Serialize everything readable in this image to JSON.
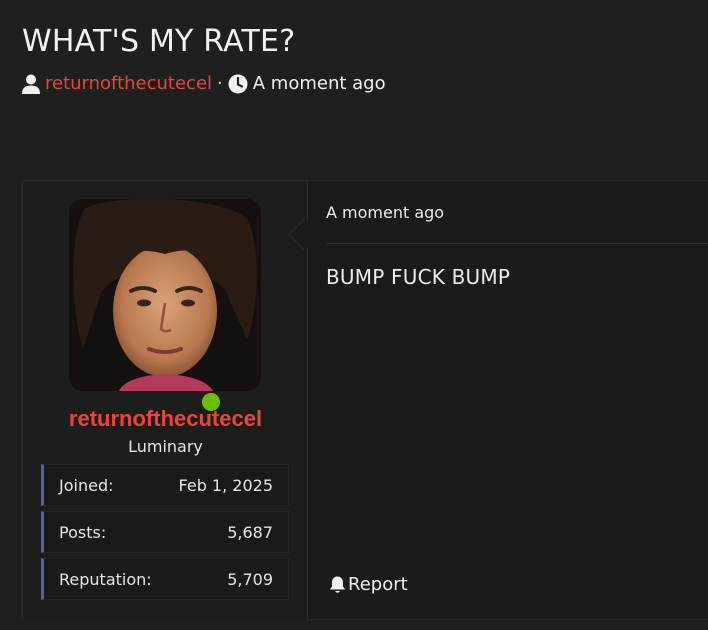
{
  "thread": {
    "title": "WHAT'S MY RATE?",
    "author": "returnofthecutecel",
    "separator": "·",
    "time": "A moment ago"
  },
  "post": {
    "date": "A moment ago",
    "body": "BUMP FUCK BUMP",
    "report_label": "Report"
  },
  "user": {
    "name": "returnofthecutecel",
    "title": "Luminary",
    "online": true,
    "stats": [
      {
        "label": "Joined:",
        "value": "Feb 1, 2025"
      },
      {
        "label": "Posts:",
        "value": "5,687"
      },
      {
        "label": "Reputation:",
        "value": "5,709"
      }
    ]
  },
  "colors": {
    "background": "#1f1f1f",
    "accent_red": "#e8453c",
    "online_green": "#6cbf00",
    "stat_border": "#5560a8"
  },
  "icons": {
    "author": "user-icon",
    "time": "clock-icon",
    "report": "bell-icon"
  }
}
